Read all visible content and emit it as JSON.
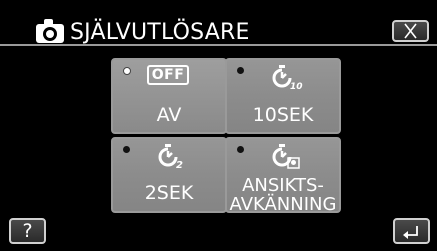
{
  "title": "SJÄLVUTLÖSARE",
  "options": [
    {
      "label": "AV",
      "icon_text": "OFF",
      "icon": "off-badge-icon",
      "selected": true
    },
    {
      "label": "10SEK",
      "icon_text": "10",
      "icon": "self-timer-10-icon",
      "selected": false
    },
    {
      "label": "2SEK",
      "icon_text": "2",
      "icon": "self-timer-2-icon",
      "selected": false
    },
    {
      "label_line1": "ANSIKTS-",
      "label_line2": "AVKÄNNING",
      "icon": "face-detection-timer-icon",
      "selected": false
    }
  ],
  "help_label": "?",
  "icons": {
    "camera": "camera-icon",
    "close": "close-icon",
    "back": "return-icon"
  },
  "colors": {
    "background": "#000000",
    "tile": "#8c8c8c",
    "text": "#ffffff"
  }
}
